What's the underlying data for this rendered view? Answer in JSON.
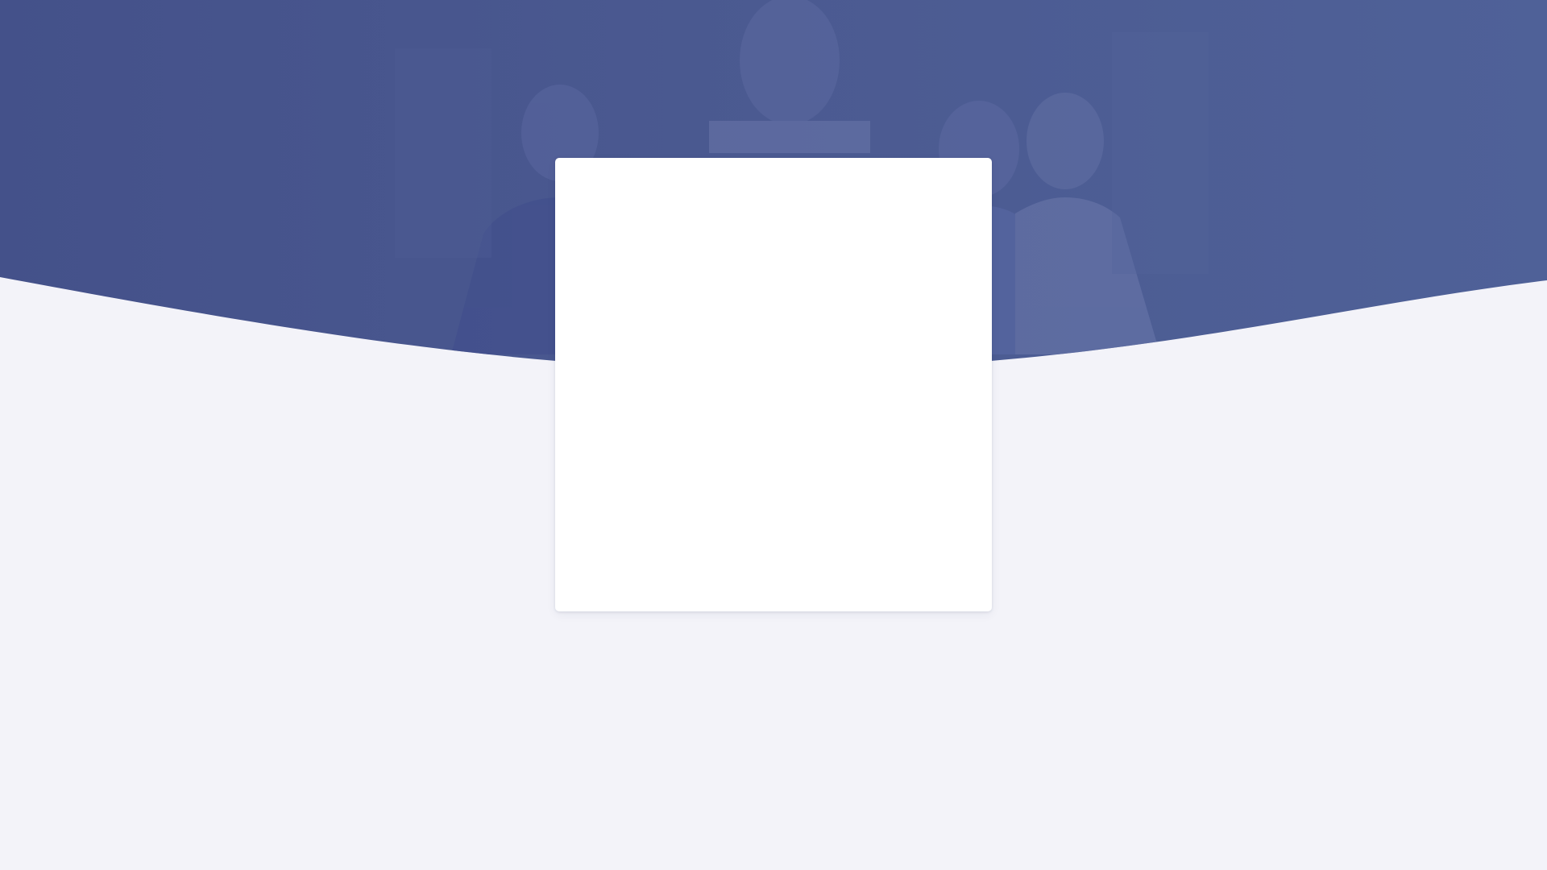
{
  "colors": {
    "hero_overlay": "#4b5a8f",
    "page_background": "#f3f3f9",
    "card_background": "#ffffff"
  },
  "hero": {
    "image": "photo-of-medical-staff"
  },
  "card": {
    "state": "blank"
  }
}
